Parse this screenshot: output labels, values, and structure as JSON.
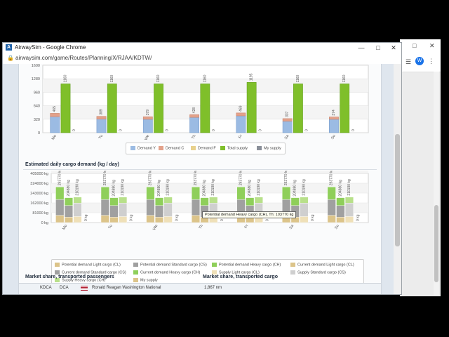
{
  "window": {
    "title": "AirwaySim - Google Chrome",
    "url": "airwaysim.com/game/Routes/Planning/X/RJAA/KDTW/",
    "controls": {
      "minimize": "—",
      "maximize": "□",
      "close": "✕"
    },
    "favicon_text": "A"
  },
  "side_window": {
    "button1": "□",
    "button2": "✕",
    "avatar": "W"
  },
  "colors": {
    "demand_y": "#9bbbe3",
    "demand_c": "#e3a18a",
    "demand_f": "#e8d18d",
    "total_supply": "#7fbf2a",
    "my_supply": "#8a8f99",
    "light_cargo": "#dcc48a",
    "standard_cargo": "#a0a0a0",
    "heavy_cargo": "#8fcf5a"
  },
  "chart_data": [
    {
      "type": "bar",
      "categories": [
        "Mo",
        "Tu",
        "We",
        "Th",
        "Fr",
        "Sa",
        "Su"
      ],
      "ylim": [
        0,
        1600
      ],
      "yticks": [
        "0",
        "320",
        "640",
        "960",
        "1280",
        "1600"
      ],
      "series": [
        {
          "name": "Demand Y",
          "values": [
            380,
            322,
            318,
            364,
            400,
            272,
            318
          ]
        },
        {
          "name": "Demand C",
          "values": [
            80,
            67,
            61,
            64,
            69,
            63,
            56
          ]
        },
        {
          "name": "Demand F",
          "values": [
            0,
            0,
            0,
            0,
            0,
            0,
            0
          ]
        },
        {
          "name": "Total supply",
          "values": [
            1160,
            1160,
            1160,
            1160,
            1195,
            1160,
            1160
          ]
        },
        {
          "name": "My supply",
          "values": [
            0,
            0,
            0,
            0,
            0,
            0,
            0
          ]
        }
      ],
      "demand_labels": [
        "465",
        "389",
        "379",
        "428",
        "469",
        "337",
        "374"
      ],
      "supply_labels": [
        "1160",
        "1160",
        "1160",
        "1160",
        "1195",
        "1160",
        "1160"
      ],
      "my_supply_labels": [
        "0",
        "0",
        "0",
        "0",
        "0",
        "0",
        "0"
      ]
    },
    {
      "type": "bar",
      "title": "Estimated daily cargo demand (kg / day)",
      "categories": [
        "Mo",
        "Tu",
        "We",
        "Th",
        "Fr",
        "Sa",
        "Su"
      ],
      "ylim": [
        0,
        405000
      ],
      "yticks": [
        "0 kg",
        "81000 kg",
        "162000 kg",
        "243000 kg",
        "324000 kg",
        "405000 kg"
      ],
      "series": [
        {
          "name": "Potential demand Light cargo (CL)",
          "values": [
            60000,
            60000,
            60000,
            60000,
            60000,
            60000,
            60000
          ]
        },
        {
          "name": "Potential demand Standard cargo (CS)",
          "values": [
            130000,
            130000,
            130000,
            130000,
            130000,
            130000,
            130000
          ]
        },
        {
          "name": "Potential demand Heavy cargo (CH)",
          "values": [
            103770,
            103770,
            103770,
            103770,
            103770,
            103770,
            103770
          ]
        },
        {
          "name": "Current demand Light cargo (CL)",
          "values": [
            45000,
            45000,
            45000,
            45000,
            45000,
            45000,
            45000
          ]
        },
        {
          "name": "Current demand Standard cargo (CS)",
          "values": [
            95000,
            95000,
            95000,
            95000,
            95000,
            95000,
            95000
          ]
        },
        {
          "name": "Current demand Heavy cargo (CH)",
          "values": [
            64880,
            64880,
            64880,
            64880,
            64880,
            64880,
            64880
          ]
        },
        {
          "name": "Supply Light cargo (CL)",
          "values": [
            50000,
            50000,
            50000,
            50000,
            50000,
            50000,
            50000
          ]
        },
        {
          "name": "Supply Standard cargo (CS)",
          "values": [
            110000,
            110000,
            110000,
            110000,
            110000,
            110000,
            110000
          ]
        },
        {
          "name": "Supply Heavy cargo (CH)",
          "values": [
            50190,
            50190,
            50190,
            50190,
            50190,
            50190,
            50190
          ]
        },
        {
          "name": "My supply",
          "values": [
            0,
            0,
            0,
            0,
            0,
            0,
            0
          ]
        }
      ],
      "bar_labels": [
        "293770 kg",
        "204880 kg",
        "210190 kg",
        "0 kg"
      ],
      "tooltip": "Potential demand Heavy cargo (CH), Th: 103770 kg"
    }
  ],
  "legend1": [
    "Demand Y",
    "Demand C",
    "Demand F",
    "Total supply",
    "My supply"
  ],
  "sections": {
    "market_pax": "Market share, transported passengers",
    "market_cargo": "Market share, transported cargo"
  },
  "bottom_row": {
    "code": "KDCA",
    "iata": "DCA",
    "name": "Ronald Reagan Washington National",
    "distance": "1,867 nm"
  }
}
